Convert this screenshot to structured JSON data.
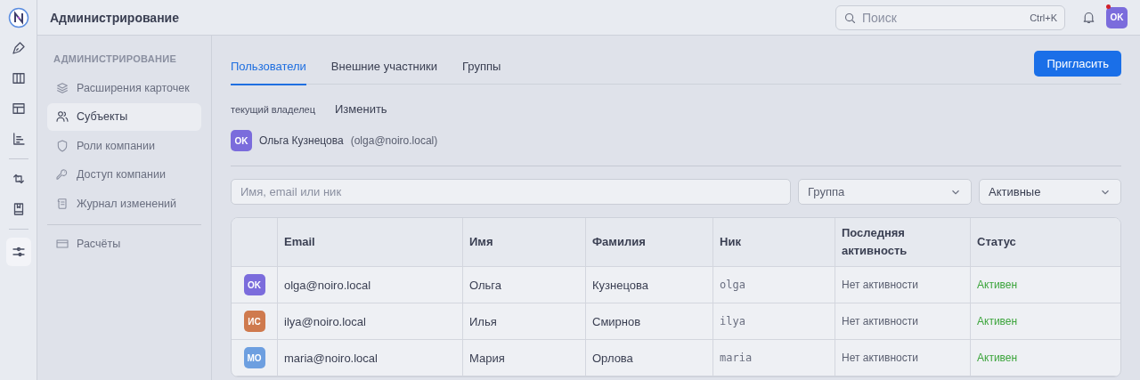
{
  "rail": {
    "items": [
      {
        "kind": "pen",
        "selected": false
      },
      {
        "kind": "columns",
        "selected": false
      },
      {
        "kind": "table",
        "selected": false
      },
      {
        "kind": "chart",
        "selected": false
      },
      {
        "kind": "divider"
      },
      {
        "kind": "sync",
        "selected": false
      },
      {
        "kind": "book",
        "selected": false
      },
      {
        "kind": "divider"
      },
      {
        "kind": "sliders",
        "selected": true
      }
    ]
  },
  "topbar": {
    "title": "Администрирование",
    "search": {
      "placeholder": "Поиск",
      "shortcut": "Ctrl+K"
    },
    "notification": true,
    "avatar": {
      "initials": "OK",
      "color": "#7b6cdc"
    }
  },
  "sidebar": {
    "heading": "АДМИНИСТРИРОВАНИЕ",
    "items": [
      {
        "label": "Расширения карточек",
        "kind": "layers",
        "selected": false
      },
      {
        "label": "Субъекты",
        "kind": "users",
        "selected": true
      },
      {
        "label": "Роли компании",
        "kind": "shield",
        "selected": false
      },
      {
        "label": "Доступ компании",
        "kind": "key",
        "selected": false
      },
      {
        "label": "Журнал изменений",
        "kind": "scroll",
        "selected": false
      },
      {
        "kind": "divider"
      },
      {
        "label": "Расчёты",
        "kind": "card",
        "selected": false
      }
    ]
  },
  "tabs": [
    {
      "label": "Пользователи",
      "selected": true
    },
    {
      "label": "Внешние участники",
      "selected": false
    },
    {
      "label": "Группы",
      "selected": false
    }
  ],
  "invite_button": "Пригласить",
  "owner": {
    "label": "текущий владелец",
    "change": "Изменить",
    "initials": "OK",
    "color": "#7b6cdc",
    "name": "Ольга Кузнецова",
    "email": "(olga@noiro.local)"
  },
  "filters": {
    "search": {
      "placeholder": "Имя, email или ник"
    },
    "group": {
      "value": "Группа"
    },
    "status": {
      "value": "Активные"
    }
  },
  "table": {
    "columns": [
      "",
      "Email",
      "Имя",
      "Фамилия",
      "Ник",
      "Последняя активность",
      "Статус"
    ],
    "rows": [
      {
        "initials": "OK",
        "color": "#7b6cdc",
        "email": "olga@noiro.local",
        "first": "Ольга",
        "last": "Кузнецова",
        "nick": "olga",
        "activity": "Нет активности",
        "status": "Активен"
      },
      {
        "initials": "ИС",
        "color": "#cf7a4e",
        "email": "ilya@noiro.local",
        "first": "Илья",
        "last": "Смирнов",
        "nick": "ilya",
        "activity": "Нет активности",
        "status": "Активен"
      },
      {
        "initials": "МО",
        "color": "#6d9fe0",
        "email": "maria@noiro.local",
        "first": "Мария",
        "last": "Орлова",
        "nick": "maria",
        "activity": "Нет активности",
        "status": "Активен"
      }
    ]
  }
}
